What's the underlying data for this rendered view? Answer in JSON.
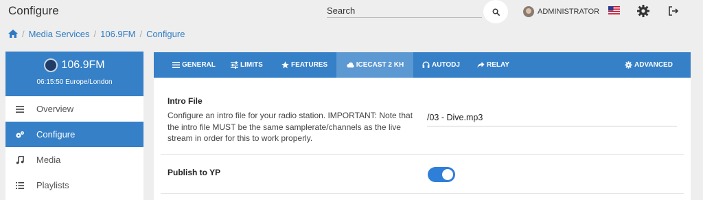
{
  "header": {
    "title": "Configure",
    "search_placeholder": "Search",
    "user_name": "ADMINISTRATOR"
  },
  "breadcrumb": [
    "Media Services",
    "106.9FM",
    "Configure"
  ],
  "sidebar": {
    "station_name": "106.9FM",
    "station_time": "06:15:50 Europe/London",
    "items": [
      {
        "label": "Overview",
        "icon": "menu-lines-icon"
      },
      {
        "label": "Configure",
        "icon": "cogs-icon",
        "active": true
      },
      {
        "label": "Media",
        "icon": "music-note-icon"
      },
      {
        "label": "Playlists",
        "icon": "list-icon"
      }
    ]
  },
  "tabs": [
    {
      "label": "GENERAL",
      "icon": "bars-icon"
    },
    {
      "label": "LIMITS",
      "icon": "sliders-icon"
    },
    {
      "label": "FEATURES",
      "icon": "star-icon"
    },
    {
      "label": "ICECAST 2 KH",
      "icon": "cloud-icon",
      "active": true
    },
    {
      "label": "AUTODJ",
      "icon": "headphones-icon"
    },
    {
      "label": "RELAY",
      "icon": "share-arrow-icon"
    },
    {
      "label": "ADVANCED",
      "icon": "gear-icon"
    }
  ],
  "settings": {
    "intro": {
      "label": "Intro File",
      "description": "Configure an intro file for your radio station. IMPORTANT: Note that the intro file MUST be the same samplerate/channels as the live stream in order for this to work properly.",
      "value": "/03 - Dive.mp3"
    },
    "publish": {
      "label": "Publish to YP",
      "enabled": true
    }
  },
  "colors": {
    "accent": "#3580c7",
    "active_tab": "#5c98d2",
    "toggle_on": "#2f7fd9",
    "link": "#2e7bc4"
  }
}
